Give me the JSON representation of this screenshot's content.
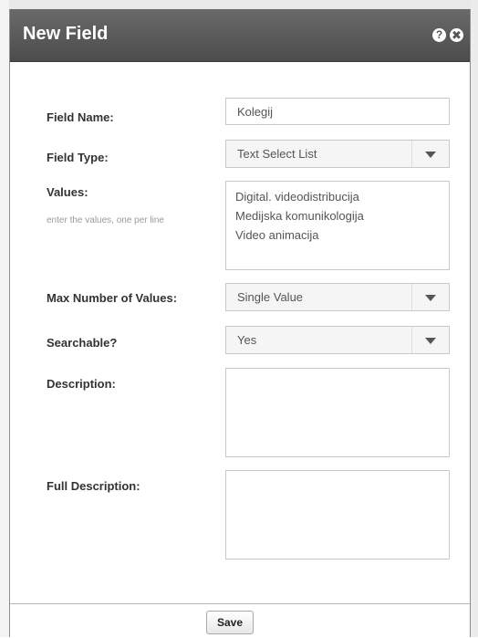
{
  "dialog": {
    "title": "New Field",
    "help_icon": "?",
    "close_icon": "✖"
  },
  "form": {
    "field_name": {
      "label": "Field Name:",
      "value": "Kolegij"
    },
    "field_type": {
      "label": "Field Type:",
      "value": "Text Select List"
    },
    "values": {
      "label": "Values:",
      "hint": "enter the values, one per line",
      "lines": [
        "Digital. videodistribucija",
        "Medijska komunikologija",
        "Video animacija"
      ]
    },
    "max_values": {
      "label": "Max Number of Values:",
      "value": "Single Value"
    },
    "searchable": {
      "label": "Searchable?",
      "value": "Yes"
    },
    "description": {
      "label": "Description:",
      "value": ""
    },
    "full_description": {
      "label": "Full Description:",
      "value": ""
    }
  },
  "footer": {
    "save_label": "Save"
  },
  "icons": {
    "help": "help-icon",
    "close": "close-icon",
    "dropdown": "chevron-down-icon"
  }
}
